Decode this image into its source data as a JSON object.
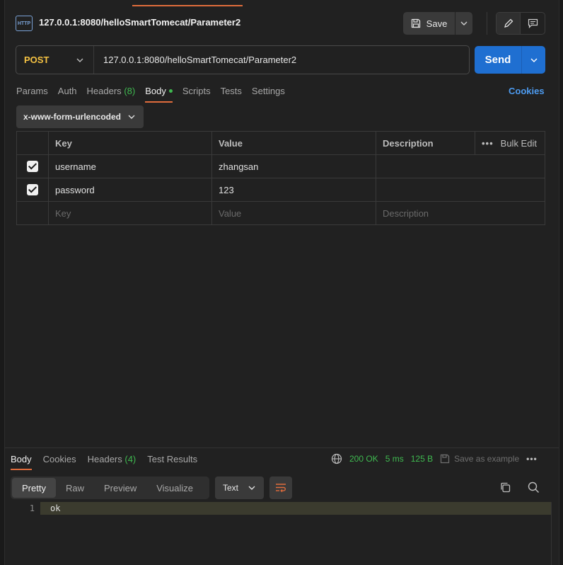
{
  "header": {
    "title": "127.0.0.1:8080/helloSmartTomecat/Parameter2",
    "http_icon_label": "HTTP",
    "save_label": "Save"
  },
  "request": {
    "method": "POST",
    "url": "127.0.0.1:8080/helloSmartTomecat/Parameter2",
    "send_label": "Send"
  },
  "tabs": {
    "params": "Params",
    "auth": "Auth",
    "headers": "Headers",
    "headers_count": "(8)",
    "body": "Body",
    "scripts": "Scripts",
    "tests": "Tests",
    "settings": "Settings",
    "cookies": "Cookies"
  },
  "body_type": "x-www-form-urlencoded",
  "params_table": {
    "columns": [
      "Key",
      "Value",
      "Description"
    ],
    "bulk_edit": "Bulk Edit",
    "rows": [
      {
        "key": "username",
        "value": "zhangsan",
        "description": "",
        "checked": true
      },
      {
        "key": "password",
        "value": "123",
        "description": "",
        "checked": true
      }
    ],
    "placeholder": {
      "key": "Key",
      "value": "Value",
      "description": "Description"
    }
  },
  "response": {
    "tabs": {
      "body": "Body",
      "cookies": "Cookies",
      "headers": "Headers",
      "headers_count": "(4)",
      "test_results": "Test Results"
    },
    "status": "200 OK",
    "time": "5 ms",
    "size": "125 B",
    "save_example": "Save as example",
    "view_tabs": [
      "Pretty",
      "Raw",
      "Preview",
      "Visualize"
    ],
    "format": "Text",
    "lines": [
      {
        "num": "1",
        "text": "ok"
      }
    ]
  },
  "colors": {
    "accent": "#e06c3c",
    "send": "#1f6fd1",
    "method": "#f6c343",
    "success": "#3fb950",
    "link": "#4d9bf0"
  }
}
